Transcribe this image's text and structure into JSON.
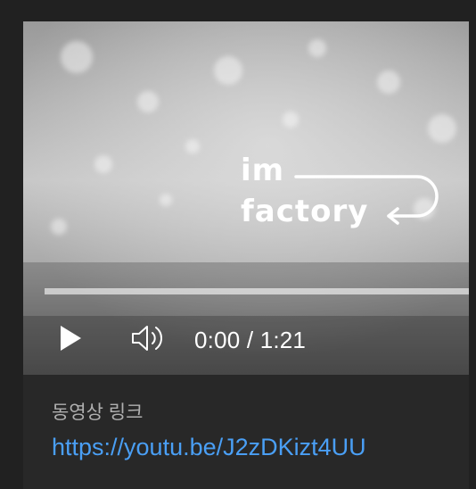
{
  "player": {
    "logo_line1": "im",
    "logo_line2": "factory",
    "current_time": "0:00",
    "separator": " / ",
    "duration": "1:21",
    "progress": 0
  },
  "info": {
    "label": "동영상 링크",
    "url": "https://youtu.be/J2zDKizt4UU"
  },
  "colors": {
    "page_bg": "#212121",
    "card_bg": "#282828",
    "link": "#4a9ff5",
    "label": "#b0b0b0"
  },
  "icons": {
    "play": "play-icon",
    "volume": "volume-icon"
  }
}
